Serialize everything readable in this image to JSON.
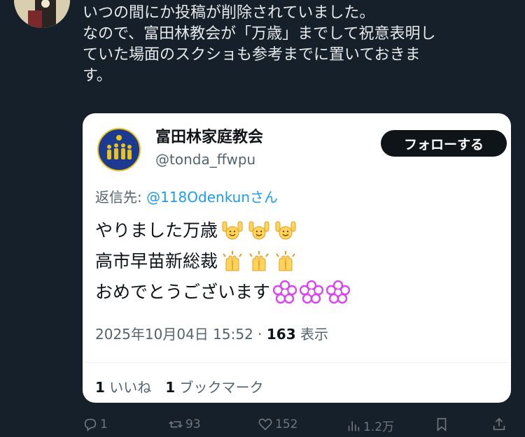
{
  "post": {
    "lines": [
      "いつの間にか投稿が削除されていました。",
      "なので、富田林教会が「万歳」までして祝意表明し",
      "ていた場面のスクショも参考までに置いておきま",
      "す。"
    ]
  },
  "quoted": {
    "name": "富田林家庭教会",
    "handle": "@tonda_ffwpu",
    "follow_label": "フォローする",
    "reply_prefix": "返信先: ",
    "reply_mention": "@118Odenkun",
    "reply_suffix": "さん",
    "body": [
      {
        "text": "やりました万歳",
        "emoji": "raising-hands-emoji",
        "count": 3
      },
      {
        "text": "高市早苗新総裁",
        "emoji": "clapping-hands-emoji",
        "count": 3
      },
      {
        "text": "おめでとうございます",
        "emoji": "cherry-blossom-emoji",
        "count": 3
      }
    ],
    "timestamp": "2025年10月04日 15:52",
    "separator": " · ",
    "view_count": "163",
    "view_label": " 表示",
    "likes_count": "1",
    "likes_label": " いいね",
    "bookmarks_count": "1",
    "bookmarks_label": " ブックマーク"
  },
  "actions": {
    "reply_count": "1",
    "repost_count": "93",
    "like_count": "152",
    "views_count": "1.2万"
  },
  "colors": {
    "background": "#15202b",
    "mention": "#1d9bf0",
    "secondary": "#536471",
    "blossom": "#d946ef"
  }
}
